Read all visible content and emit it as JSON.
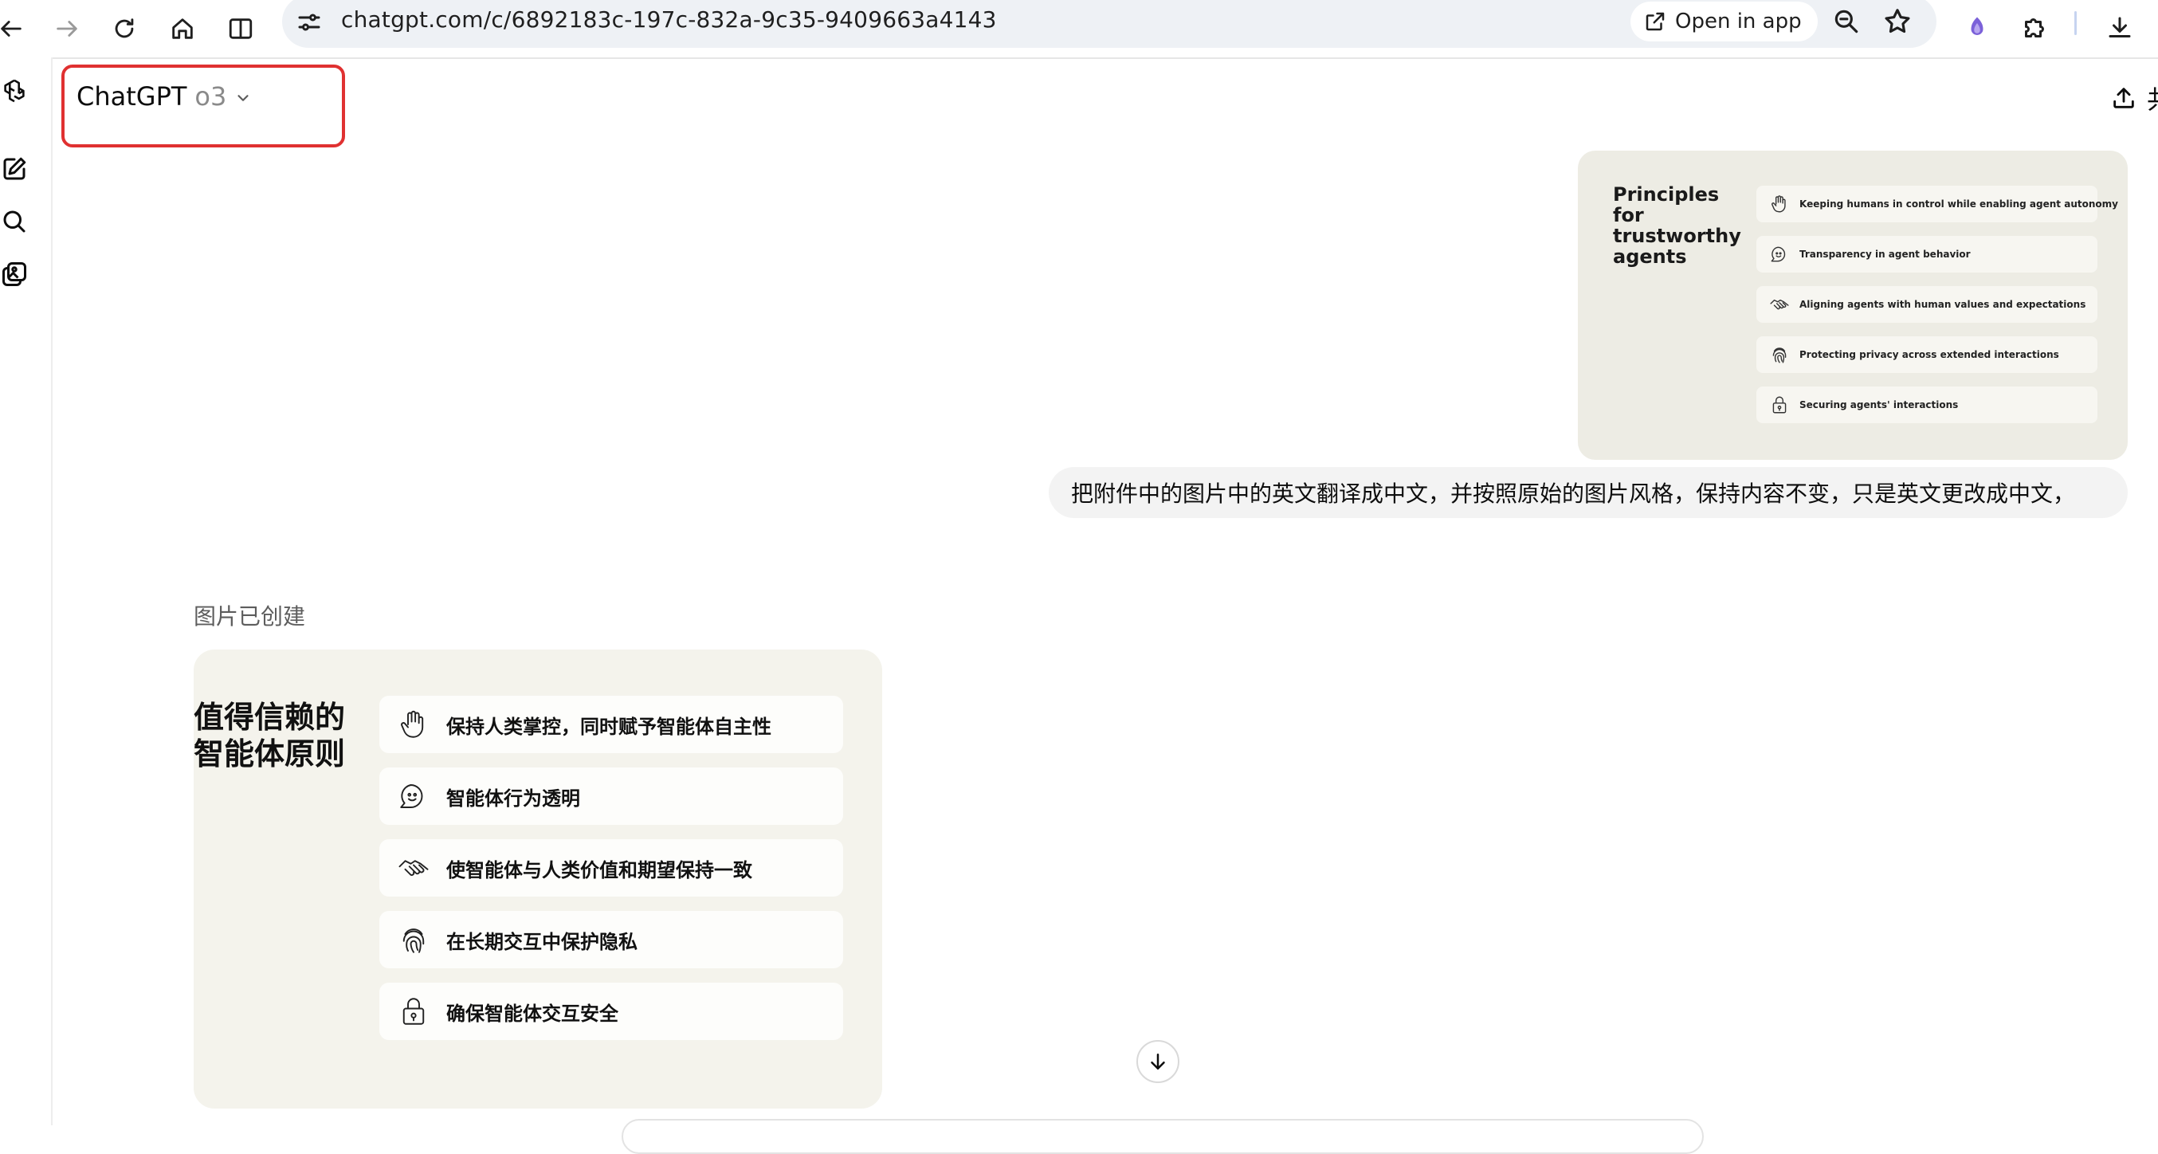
{
  "browser": {
    "url": "chatgpt.com/c/6892183c-197c-832a-9c35-9409663a4143",
    "open_in_app_label": "Open in app",
    "extension_color": "#7b61d9"
  },
  "header": {
    "model_name": "ChatGPT",
    "model_version": "o3",
    "share_partial_label": "共",
    "highlight_color": "#e03131"
  },
  "user_message": {
    "attachment": {
      "title": "Principles for trustworthy agents",
      "items": [
        {
          "icon": "hand-icon",
          "label": "Keeping humans in control while enabling agent autonomy"
        },
        {
          "icon": "speech-bubble-icon",
          "label": "Transparency in agent behavior"
        },
        {
          "icon": "handshake-icon",
          "label": "Aligning agents with human values and expectations"
        },
        {
          "icon": "fingerprint-icon",
          "label": "Protecting privacy across extended interactions"
        },
        {
          "icon": "lock-icon",
          "label": "Securing agents' interactions"
        }
      ]
    },
    "text": "把附件中的图片中的英文翻译成中文，并按照原始的图片风格，保持内容不变，只是英文更改成中文，"
  },
  "assistant_message": {
    "status": "图片已创建",
    "image": {
      "title": "值得信赖的智能体原则",
      "items": [
        {
          "icon": "hand-icon",
          "label": "保持人类掌控，同时赋予智能体自主性"
        },
        {
          "icon": "speech-bubble-icon",
          "label": "智能体行为透明"
        },
        {
          "icon": "handshake-icon",
          "label": "使智能体与人类价值和期望保持一致"
        },
        {
          "icon": "fingerprint-icon",
          "label": "在长期交互中保护隐私"
        },
        {
          "icon": "lock-icon",
          "label": "确保智能体交互安全"
        }
      ]
    }
  }
}
